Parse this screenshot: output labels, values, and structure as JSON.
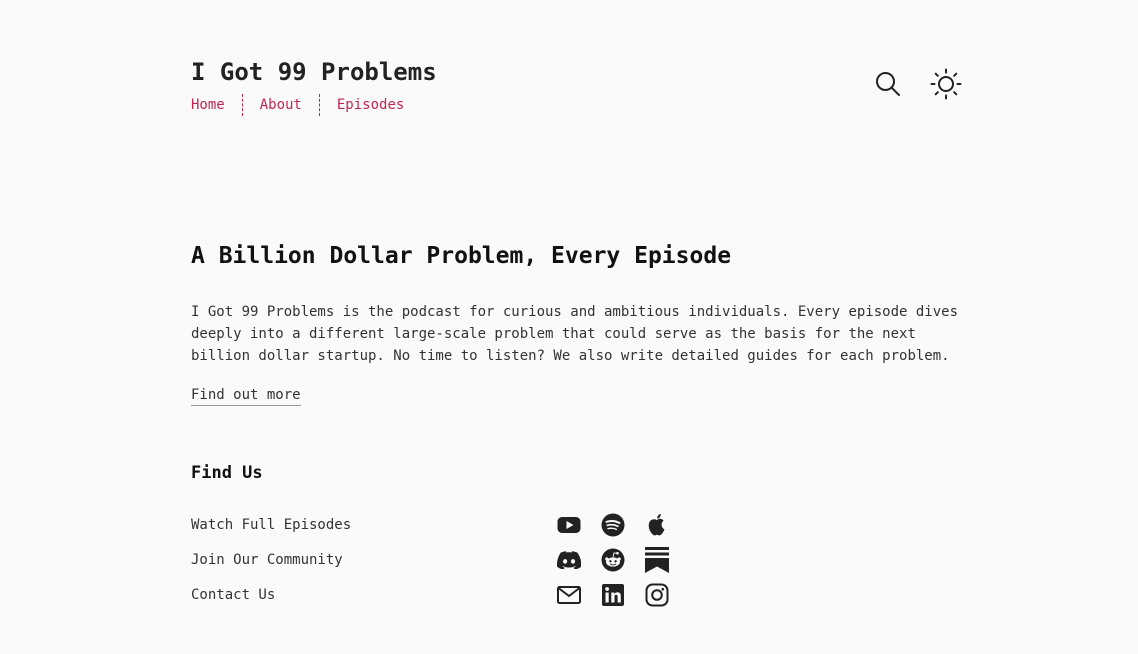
{
  "header": {
    "site_title": "I Got 99 Problems",
    "nav": [
      {
        "label": "Home"
      },
      {
        "label": "About"
      },
      {
        "label": "Episodes"
      }
    ],
    "icons": [
      "search-icon",
      "sun-icon"
    ]
  },
  "hero": {
    "title": "A Billion Dollar Problem, Every Episode",
    "text": "I Got 99 Problems is the podcast for curious and ambitious individuals. Every episode dives deeply into a different large-scale problem that could serve as the basis for the next billion dollar startup. No time to listen? We also write detailed guides for each problem.",
    "link_label": "Find out more"
  },
  "find_us": {
    "title": "Find Us",
    "rows": [
      {
        "label": "Watch Full Episodes",
        "icons": [
          "youtube-icon",
          "spotify-icon",
          "apple-icon"
        ]
      },
      {
        "label": "Join Our Community",
        "icons": [
          "discord-icon",
          "reddit-icon",
          "substack-icon"
        ]
      },
      {
        "label": "Contact Us",
        "icons": [
          "email-icon",
          "linkedin-icon",
          "instagram-icon"
        ]
      }
    ]
  },
  "colors": {
    "accent": "#c0264f",
    "background": "#fafafa",
    "text": "#222222"
  }
}
